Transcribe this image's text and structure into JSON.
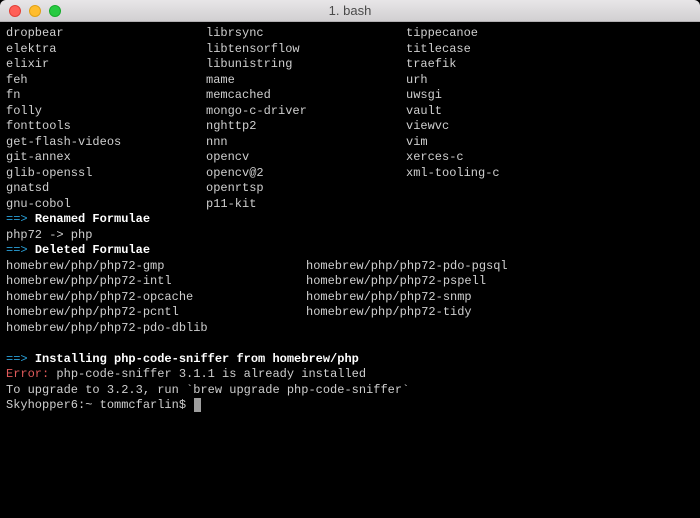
{
  "window": {
    "title": "1. bash"
  },
  "formulae_cols3": [
    [
      "dropbear",
      "librsync",
      "tippecanoe"
    ],
    [
      "elektra",
      "libtensorflow",
      "titlecase"
    ],
    [
      "elixir",
      "libunistring",
      "traefik"
    ],
    [
      "feh",
      "mame",
      "urh"
    ],
    [
      "fn",
      "memcached",
      "uwsgi"
    ],
    [
      "folly",
      "mongo-c-driver",
      "vault"
    ],
    [
      "fonttools",
      "nghttp2",
      "viewvc"
    ],
    [
      "get-flash-videos",
      "nnn",
      "vim"
    ],
    [
      "git-annex",
      "opencv",
      "xerces-c"
    ],
    [
      "glib-openssl",
      "opencv@2",
      "xml-tooling-c"
    ],
    [
      "gnatsd",
      "openrtsp",
      ""
    ],
    [
      "gnu-cobol",
      "p11-kit",
      ""
    ]
  ],
  "sections": {
    "arrow": "==>",
    "renamed_label": "Renamed Formulae",
    "renamed_body": "php72 -> php",
    "deleted_label": "Deleted Formulae"
  },
  "deleted_cols2": [
    [
      "homebrew/php/php72-gmp",
      "homebrew/php/php72-pdo-pgsql"
    ],
    [
      "homebrew/php/php72-intl",
      "homebrew/php/php72-pspell"
    ],
    [
      "homebrew/php/php72-opcache",
      "homebrew/php/php72-snmp"
    ],
    [
      "homebrew/php/php72-pcntl",
      "homebrew/php/php72-tidy"
    ],
    [
      "homebrew/php/php72-pdo-dblib",
      ""
    ]
  ],
  "install": {
    "heading": "Installing php-code-sniffer from homebrew/php",
    "error_label": "Error:",
    "error_msg": " php-code-sniffer 3.1.1 is already installed",
    "upgrade_msg": "To upgrade to 3.2.3, run `brew upgrade php-code-sniffer`"
  },
  "prompt": {
    "host": "Skyhopper6:~ tommcfarlin$ "
  }
}
